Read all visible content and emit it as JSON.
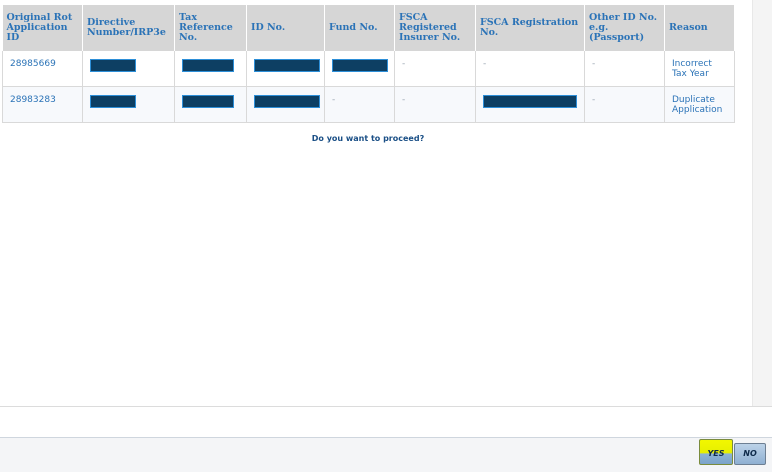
{
  "table": {
    "headers": [
      "Original Rot Application ID",
      "Directive Number/IRP3e",
      "Tax Reference No.",
      "ID No.",
      "Fund No.",
      "FSCA Registered Insurer No.",
      "FSCA Registration No.",
      "Other ID No. e.g. (Passport)",
      "Reason"
    ],
    "rows": [
      {
        "app_id": "28985669",
        "directive": "",
        "tax_ref": "",
        "id_no": "",
        "fund_no": "",
        "fsca_insurer": "-",
        "fsca_reg": "-",
        "other_id": "-",
        "reason": "Incorrect Tax Year"
      },
      {
        "app_id": "28983283",
        "directive": "",
        "tax_ref": "",
        "id_no": "",
        "fund_no": "-",
        "fsca_insurer": "-",
        "fsca_reg": "",
        "other_id": "-",
        "reason": "Duplicate Application"
      }
    ]
  },
  "prompt": "Do you want to proceed?",
  "buttons": {
    "yes": "YES",
    "no": "NO"
  },
  "colors": {
    "header_bg": "#d6d6d6",
    "link_text": "#2b73b7",
    "redaction": "#0d3f63",
    "yes_highlight": "#f2f700"
  }
}
